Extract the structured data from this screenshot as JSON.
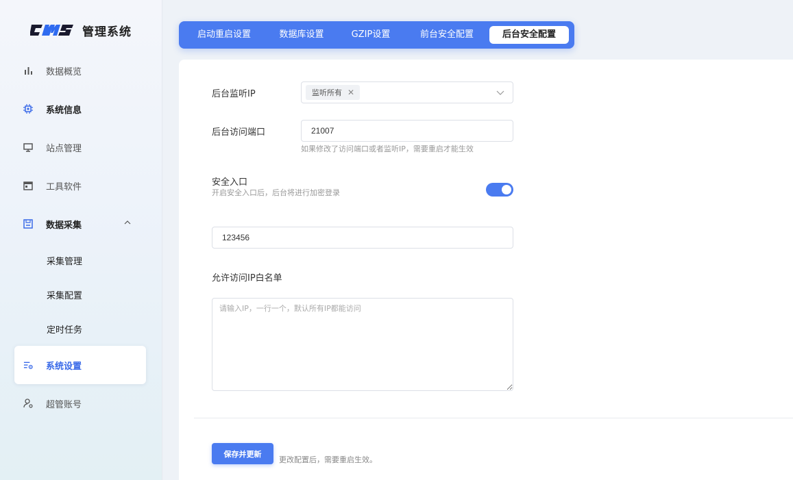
{
  "app": {
    "logo_text": "管理系统"
  },
  "sidebar": {
    "items": [
      {
        "label": "数据概览",
        "icon": "bar-chart-icon"
      },
      {
        "label": "系统信息",
        "icon": "chip-icon"
      },
      {
        "label": "站点管理",
        "icon": "monitor-icon"
      },
      {
        "label": "工具软件",
        "icon": "window-icon"
      },
      {
        "label": "数据采集",
        "icon": "download-box-icon"
      },
      {
        "label": "系统设置",
        "icon": "settings-list-icon"
      },
      {
        "label": "超管账号",
        "icon": "user-gear-icon"
      }
    ],
    "sub_items": [
      "采集管理",
      "采集配置",
      "定时任务"
    ]
  },
  "tabs": [
    "启动重启设置",
    "数据库设置",
    "GZIP设置",
    "前台安全配置",
    "后台安全配置"
  ],
  "active_tab": "后台安全配置",
  "form": {
    "listen_ip_label": "后台监听IP",
    "listen_ip_tag": "监听所有",
    "port_label": "后台访问端口",
    "port_value": "21007",
    "port_hint": "如果修改了访问端口或者监听IP，需要重启才能生效",
    "secure_entry_label": "安全入口",
    "secure_entry_hint": "开启安全入口后，后台将进行加密登录",
    "secure_entry_enabled": true,
    "secure_entry_value": "123456",
    "whitelist_label": "允许访问IP白名单",
    "whitelist_placeholder": "请输入IP，一行一个，默认所有IP都能访问",
    "save_label": "保存并更新",
    "save_hint": "更改配置后，需要重启生效。"
  },
  "colors": {
    "accent": "#4a7bf0"
  }
}
